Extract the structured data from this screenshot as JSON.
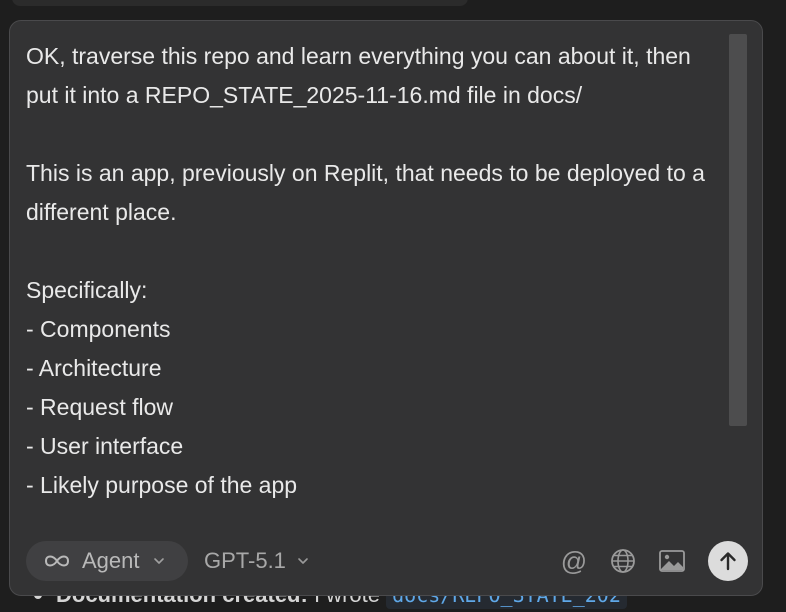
{
  "background": {
    "message_bold": "Documentation created:",
    "message_text": "I wrote",
    "message_code": "docs/REPO_STATE_202"
  },
  "composer": {
    "prompt_text": "OK, traverse this repo and learn everything you can about it, then put it into a REPO_STATE_2025-11-16.md file in docs/\n\nThis is an app, previously on Replit, that needs to be deployed to a different place.\n\nSpecifically:\n- Components\n- Architecture\n- Request flow\n- User interface\n- Likely purpose of the app",
    "mode_label": "Agent",
    "mode_icon": "infinity-icon",
    "model_label": "GPT-5.1",
    "actions": {
      "mention": "@",
      "mention_icon": "at-icon",
      "web_icon": "globe-icon",
      "image_icon": "image-icon",
      "send_icon": "arrow-up-icon"
    },
    "colors": {
      "panel_bg": "#333334",
      "panel_border": "#4a4a4c",
      "page_bg": "#1e1e1e",
      "send_button": "#dcdcdc",
      "code_text": "#5fa8e8"
    }
  }
}
